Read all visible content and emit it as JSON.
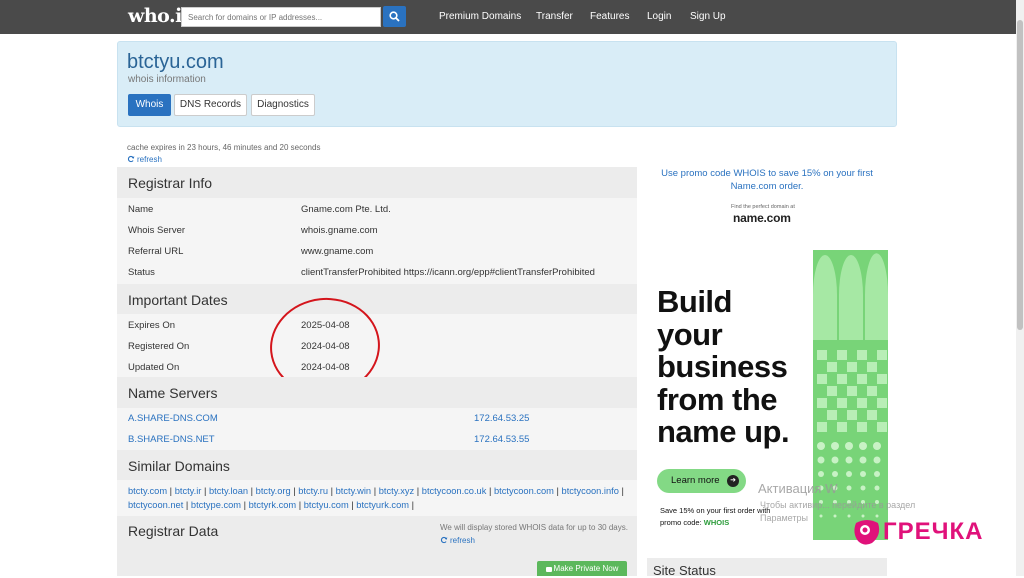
{
  "nav": {
    "logo": "who.is",
    "search_placeholder": "Search for domains or IP addresses...",
    "links": [
      "Premium Domains",
      "Transfer",
      "Features",
      "Login",
      "Sign Up"
    ]
  },
  "header": {
    "domain": "btctyu.com",
    "subtitle": "whois information",
    "tabs": [
      "Whois",
      "DNS Records",
      "Diagnostics"
    ],
    "active_tab": "Whois"
  },
  "cache": {
    "text": "cache expires in 23 hours, 46 minutes and 20 seconds",
    "refresh": "refresh"
  },
  "registrar_info": {
    "title": "Registrar Info",
    "rows": [
      {
        "label": "Name",
        "value": "Gname.com Pte. Ltd."
      },
      {
        "label": "Whois Server",
        "value": "whois.gname.com"
      },
      {
        "label": "Referral URL",
        "value": "www.gname.com"
      },
      {
        "label": "Status",
        "value": "clientTransferProhibited https://icann.org/epp#clientTransferProhibited"
      }
    ]
  },
  "important_dates": {
    "title": "Important Dates",
    "rows": [
      {
        "label": "Expires On",
        "value": "2025-04-08"
      },
      {
        "label": "Registered On",
        "value": "2024-04-08"
      },
      {
        "label": "Updated On",
        "value": "2024-04-08"
      }
    ]
  },
  "name_servers": {
    "title": "Name Servers",
    "rows": [
      {
        "host": "A.SHARE-DNS.COM",
        "ip": "172.64.53.25"
      },
      {
        "host": "B.SHARE-DNS.NET",
        "ip": "172.64.53.55"
      }
    ]
  },
  "similar_domains": {
    "title": "Similar Domains",
    "domains": [
      "btcty.com",
      "btcty.ir",
      "btcty.loan",
      "btcty.org",
      "btcty.ru",
      "btcty.win",
      "btcty.xyz",
      "btctycoon.co.uk",
      "btctycoon.com",
      "btctycoon.info",
      "btctycoon.net",
      "btctype.com",
      "btctyrk.com",
      "btctyu.com",
      "btctyurk.com"
    ]
  },
  "registrar_data": {
    "title": "Registrar Data",
    "note": "We will display stored WHOIS data for up to 30 days.",
    "refresh": "refresh",
    "private_button": "Make Private Now"
  },
  "sidebar": {
    "promo": "Use promo code WHOIS to save 15% on your first Name.com order.",
    "ad_small": "Find the perfect domain at",
    "ad_logo": "name.com",
    "ad_headline": [
      "Build",
      "your",
      "business",
      "from the",
      "name up."
    ],
    "ad_button": "Learn more",
    "ad_foot_line1": "Save 15% on your first order with",
    "ad_foot_line2_prefix": "promo code:",
    "ad_foot_code": "WHOIS",
    "site_status_title": "Site Status"
  },
  "overlay": {
    "activation_title": "Активация W",
    "activation_line1": "Чтобы активир...          перейдите в раздел",
    "activation_line2": "Параметры",
    "watermark": "ГРЕЧКА"
  },
  "colors": {
    "nav_bg": "#4a4a4a",
    "link_blue": "#2a72c0",
    "header_panel": "#d9edf7",
    "ad_green": "#78d478",
    "annotation_red": "#d4151c",
    "watermark_pink": "#e0117a"
  }
}
